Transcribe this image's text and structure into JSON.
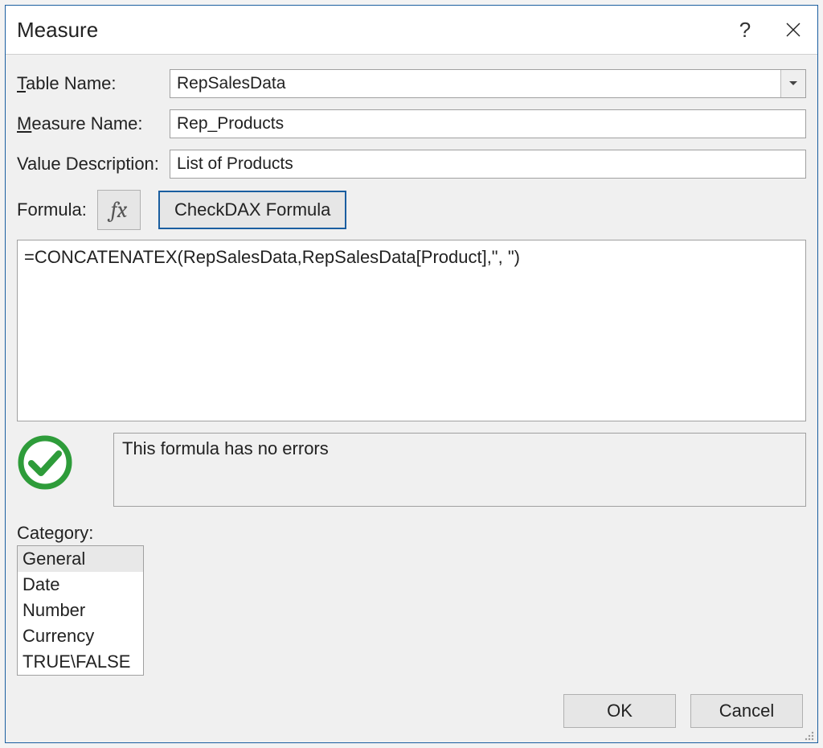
{
  "window": {
    "title": "Measure",
    "help_tooltip": "?",
    "close_tooltip": "Close"
  },
  "labels": {
    "table_name": "Table Name:",
    "measure_name": "Measure Name:",
    "value_description": "Value Description:",
    "formula": "Formula:",
    "check_dax": "Check DAX Formula",
    "category": "Category:"
  },
  "fields": {
    "table_name": "RepSalesData",
    "measure_name": "Rep_Products",
    "value_description": "List of Products",
    "formula": "=CONCATENATEX(RepSalesData,RepSalesData[Product],\", \")"
  },
  "status": {
    "ok": true,
    "message": "This formula has no errors"
  },
  "categories": {
    "items": [
      "General",
      "Date",
      "Number",
      "Currency",
      "TRUE\\FALSE"
    ],
    "selected_index": 0
  },
  "buttons": {
    "ok": "OK",
    "cancel": "Cancel"
  },
  "icons": {
    "fx": "fx"
  }
}
